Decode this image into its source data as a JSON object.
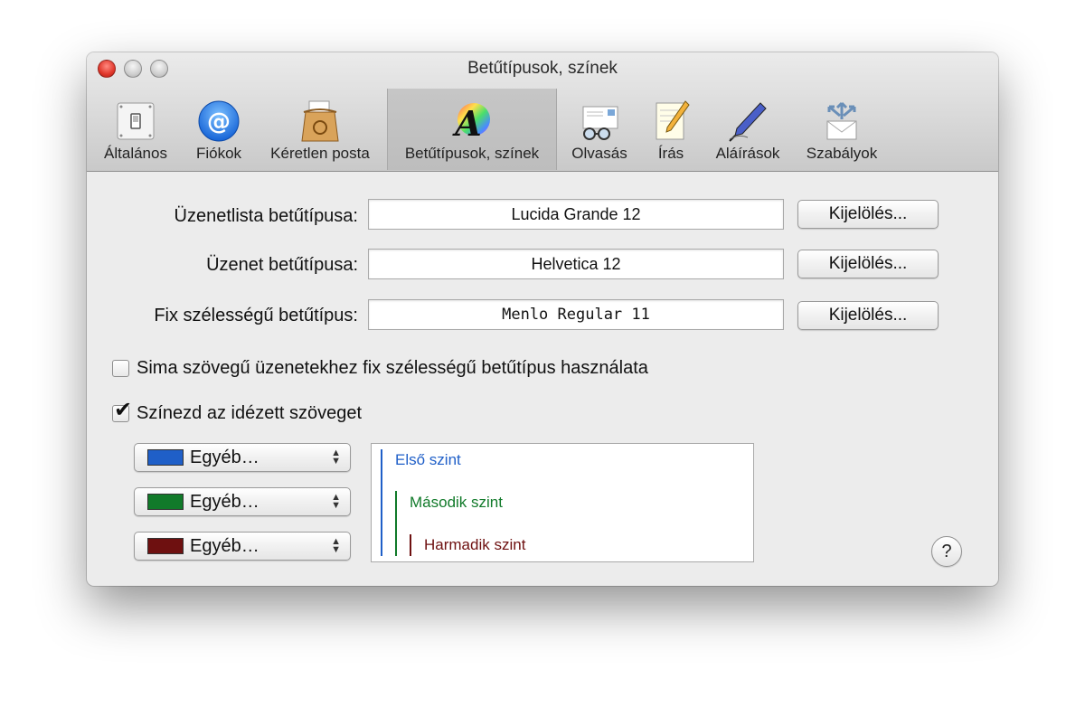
{
  "window": {
    "title": "Betűtípusok, színek"
  },
  "toolbar": {
    "items": [
      {
        "label": "Általános",
        "icon": "switch-icon"
      },
      {
        "label": "Fiókok",
        "icon": "at-sign-icon"
      },
      {
        "label": "Kéretlen posta",
        "icon": "junk-mail-bag-icon"
      },
      {
        "label": "Betűtípusok, színek",
        "icon": "font-color-icon",
        "selected": true
      },
      {
        "label": "Olvasás",
        "icon": "reading-glasses-icon"
      },
      {
        "label": "Írás",
        "icon": "notepad-pencil-icon"
      },
      {
        "label": "Aláírások",
        "icon": "fountain-pen-icon"
      },
      {
        "label": "Szabályok",
        "icon": "rules-envelope-icon"
      }
    ]
  },
  "fonts": {
    "message_list": {
      "label": "Üzenetlista betűtípusa:",
      "value": "Lucida Grande 12",
      "button": "Kijelölés..."
    },
    "message": {
      "label": "Üzenet betűtípusa:",
      "value": "Helvetica 12",
      "button": "Kijelölés..."
    },
    "fixed_width": {
      "label": "Fix szélességű betűtípus:",
      "value": "Menlo Regular 11",
      "button": "Kijelölés..."
    }
  },
  "options": {
    "plain_text_fixed": {
      "label": "Sima szövegű üzenetekhez fix szélességű betűtípus használata",
      "checked": false
    },
    "color_quoted": {
      "label": "Színezd az idézett szöveget",
      "checked": true
    }
  },
  "quote_colors": [
    {
      "value": "Egyéb…",
      "color": "#1f5fc8"
    },
    {
      "value": "Egyéb…",
      "color": "#117a2a"
    },
    {
      "value": "Egyéb…",
      "color": "#6e1010"
    }
  ],
  "preview": {
    "level1": "Első szint",
    "level2": "Második szint",
    "level3": "Harmadik szint"
  },
  "help": {
    "label": "?"
  }
}
